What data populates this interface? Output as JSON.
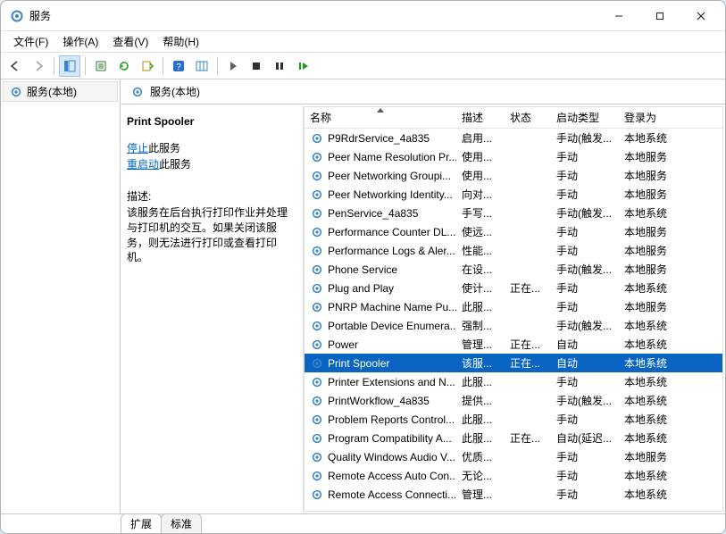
{
  "window": {
    "title": "服务"
  },
  "menus": {
    "file": "文件(F)",
    "action": "操作(A)",
    "view": "查看(V)",
    "help": "帮助(H)"
  },
  "tree": {
    "root": "服务(本地)"
  },
  "rightHeader": "服务(本地)",
  "details": {
    "selectedName": "Print Spooler",
    "stopLink": "停止",
    "stopSuffix": "此服务",
    "restartLink": "重启动",
    "restartSuffix": "此服务",
    "descriptionLabel": "描述:",
    "description": "该服务在后台执行打印作业并处理与打印机的交互。如果关闭该服务，则无法进行打印或查看打印机。"
  },
  "columns": {
    "name": "名称",
    "desc": "描述",
    "status": "状态",
    "startup": "启动类型",
    "logon": "登录为"
  },
  "services": [
    {
      "name": "P9RdrService_4a835",
      "desc": "启用...",
      "status": "",
      "startup": "手动(触发...",
      "logon": "本地系统"
    },
    {
      "name": "Peer Name Resolution Pr...",
      "desc": "使用...",
      "status": "",
      "startup": "手动",
      "logon": "本地服务"
    },
    {
      "name": "Peer Networking Groupi...",
      "desc": "使用...",
      "status": "",
      "startup": "手动",
      "logon": "本地服务"
    },
    {
      "name": "Peer Networking Identity...",
      "desc": "向对...",
      "status": "",
      "startup": "手动",
      "logon": "本地服务"
    },
    {
      "name": "PenService_4a835",
      "desc": "手写...",
      "status": "",
      "startup": "手动(触发...",
      "logon": "本地系统"
    },
    {
      "name": "Performance Counter DL...",
      "desc": "使远...",
      "status": "",
      "startup": "手动",
      "logon": "本地服务"
    },
    {
      "name": "Performance Logs & Aler...",
      "desc": "性能...",
      "status": "",
      "startup": "手动",
      "logon": "本地服务"
    },
    {
      "name": "Phone Service",
      "desc": "在设...",
      "status": "",
      "startup": "手动(触发...",
      "logon": "本地服务"
    },
    {
      "name": "Plug and Play",
      "desc": "使计...",
      "status": "正在...",
      "startup": "手动",
      "logon": "本地系统"
    },
    {
      "name": "PNRP Machine Name Pu...",
      "desc": "此服...",
      "status": "",
      "startup": "手动",
      "logon": "本地服务"
    },
    {
      "name": "Portable Device Enumera...",
      "desc": "强制...",
      "status": "",
      "startup": "手动(触发...",
      "logon": "本地系统"
    },
    {
      "name": "Power",
      "desc": "管理...",
      "status": "正在...",
      "startup": "自动",
      "logon": "本地系统"
    },
    {
      "name": "Print Spooler",
      "desc": "该服...",
      "status": "正在...",
      "startup": "自动",
      "logon": "本地系统",
      "selected": true
    },
    {
      "name": "Printer Extensions and N...",
      "desc": "此服...",
      "status": "",
      "startup": "手动",
      "logon": "本地系统"
    },
    {
      "name": "PrintWorkflow_4a835",
      "desc": "提供...",
      "status": "",
      "startup": "手动(触发...",
      "logon": "本地系统"
    },
    {
      "name": "Problem Reports Control...",
      "desc": "此服...",
      "status": "",
      "startup": "手动",
      "logon": "本地系统"
    },
    {
      "name": "Program Compatibility A...",
      "desc": "此服...",
      "status": "正在...",
      "startup": "自动(延迟...",
      "logon": "本地系统"
    },
    {
      "name": "Quality Windows Audio V...",
      "desc": "优质...",
      "status": "",
      "startup": "手动",
      "logon": "本地服务"
    },
    {
      "name": "Remote Access Auto Con...",
      "desc": "无论...",
      "status": "",
      "startup": "手动",
      "logon": "本地系统"
    },
    {
      "name": "Remote Access Connecti...",
      "desc": "管理...",
      "status": "",
      "startup": "手动",
      "logon": "本地系统"
    }
  ],
  "tabs": {
    "extended": "扩展",
    "standard": "标准"
  }
}
